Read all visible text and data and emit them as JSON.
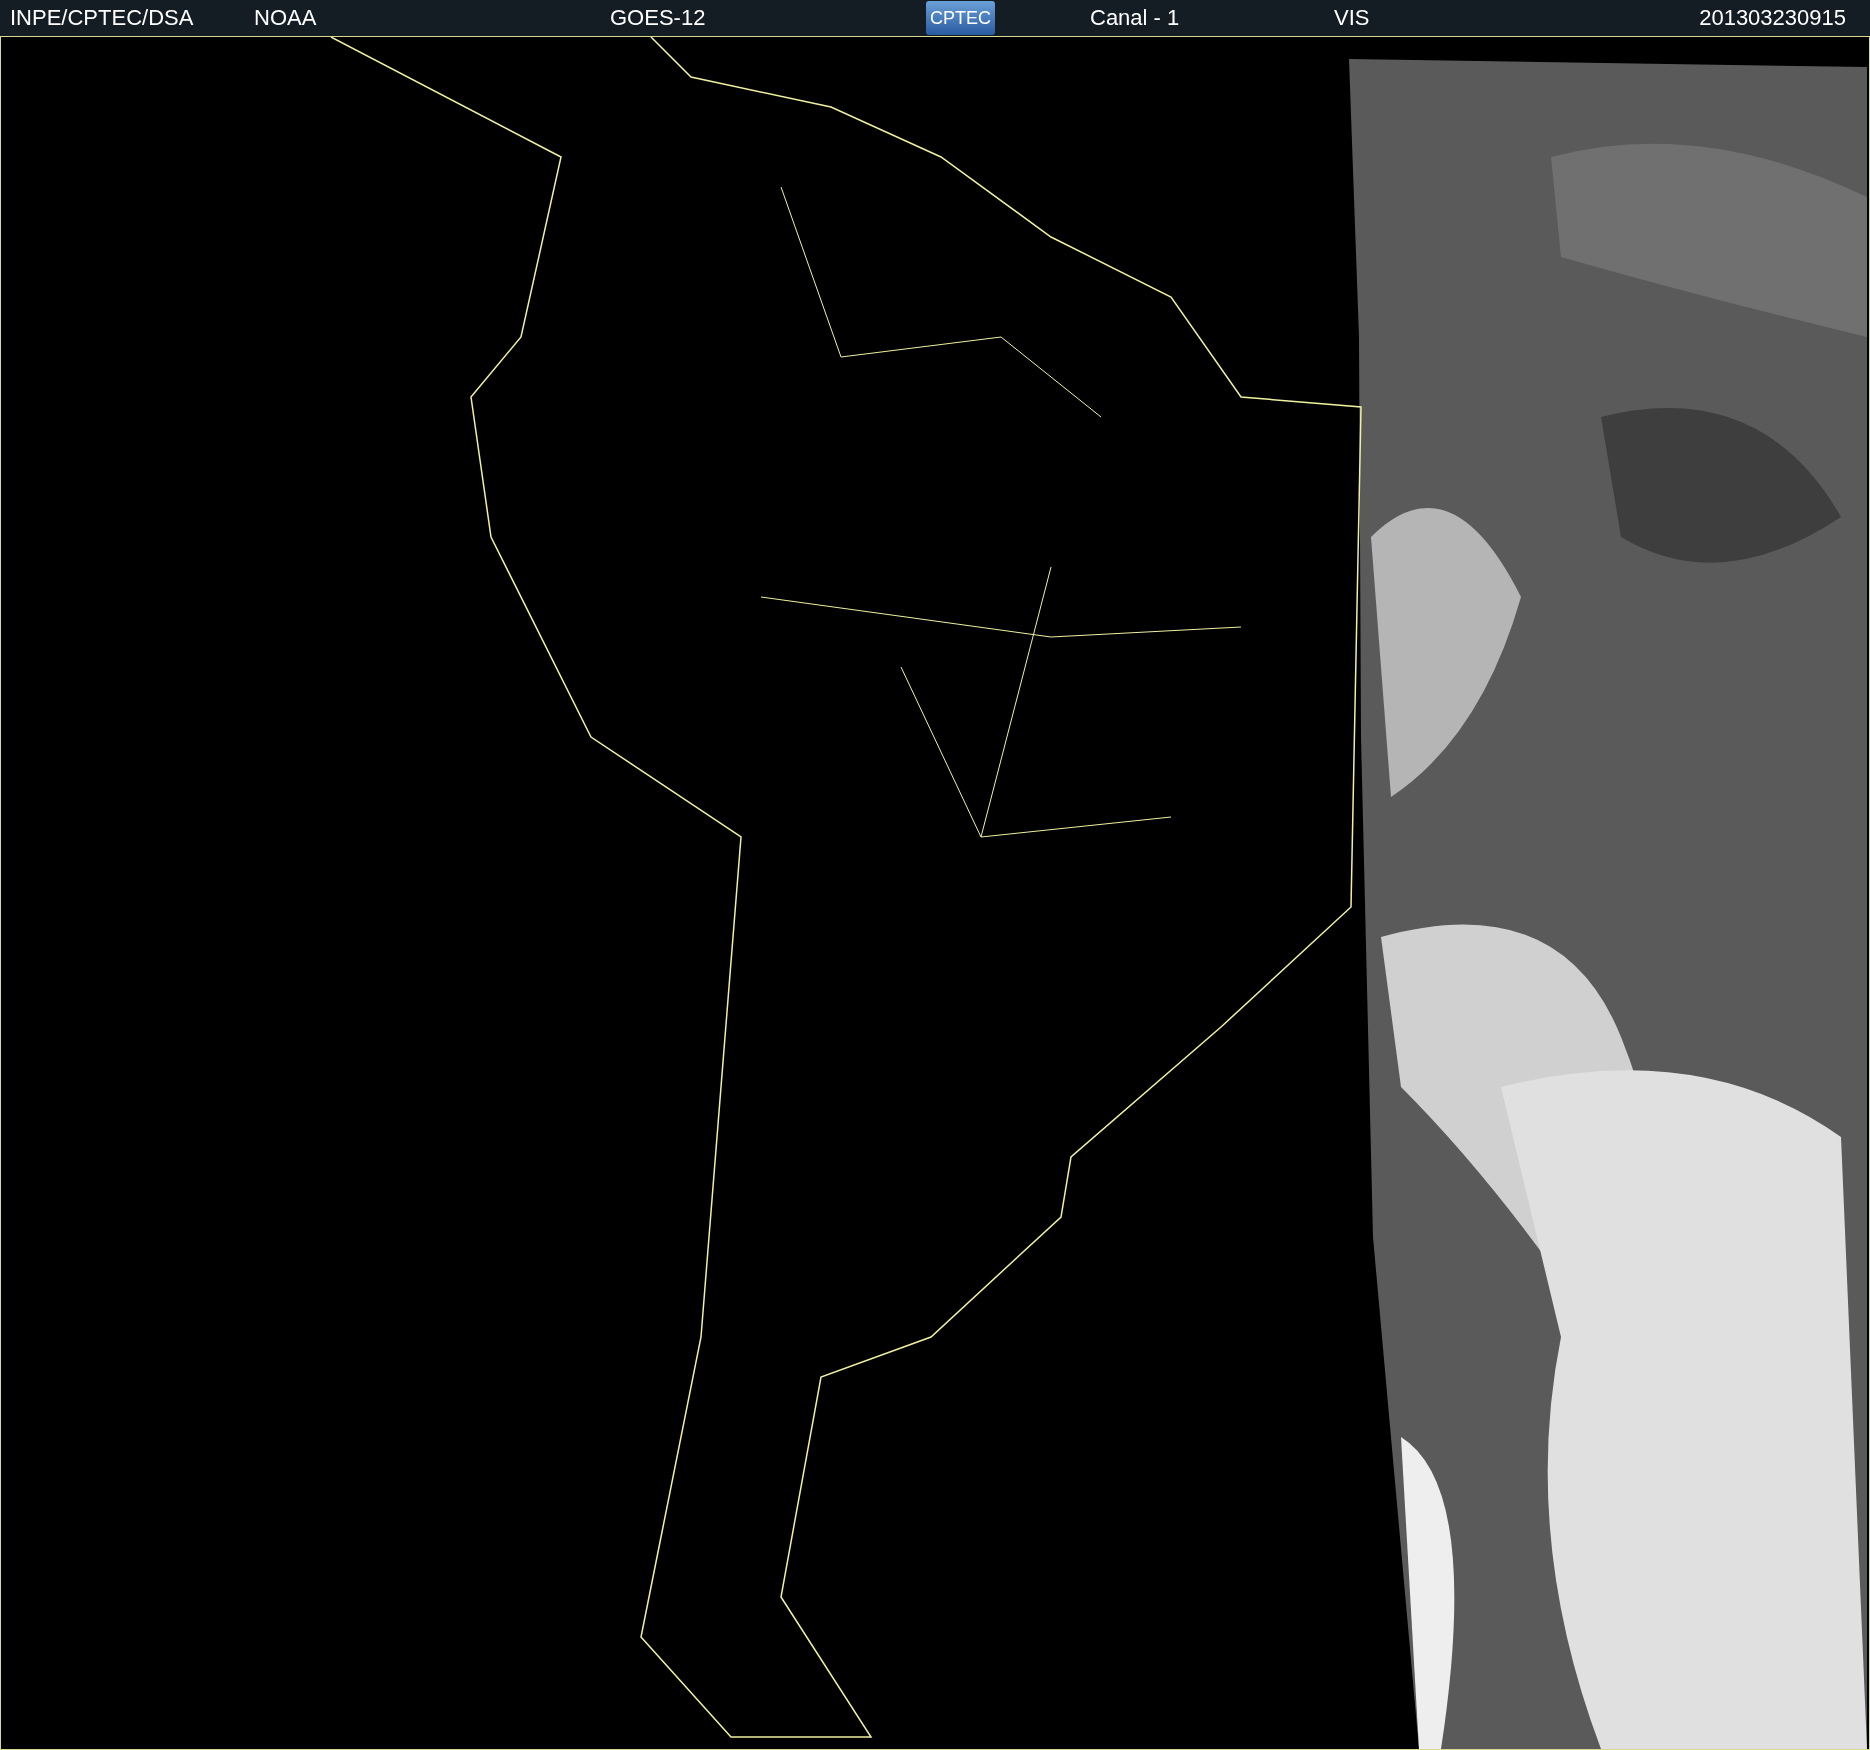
{
  "header": {
    "source": "INPE/CPTEC/DSA",
    "agency": "NOAA",
    "satellite": "GOES-12",
    "logo": "CPTEC",
    "channel": "Canal - 1",
    "band": "VIS",
    "timestamp": "201303230915"
  }
}
